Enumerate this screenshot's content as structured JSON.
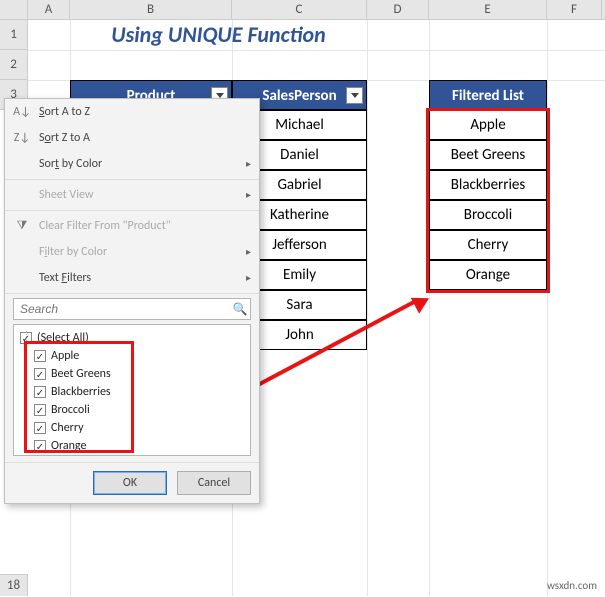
{
  "columns": [
    "A",
    "B",
    "C",
    "D",
    "E",
    "F"
  ],
  "rows": [
    "1",
    "2",
    "3"
  ],
  "lastRow": "18",
  "title": "Using UNIQUE Function",
  "headers": {
    "product": "Product",
    "salesperson": "SalesPerson",
    "filtered": "Filtered List"
  },
  "salesperson": [
    "Michael",
    "Daniel",
    "Gabriel",
    "Katherine",
    "Jefferson",
    "Emily",
    "Sara",
    "John"
  ],
  "filtered": [
    "Apple",
    "Beet Greens",
    "Blackberries",
    "Broccoli",
    "Cherry",
    "Orange"
  ],
  "menu": {
    "sortAZ": "Sort A to Z",
    "sortZA": "Sort Z to A",
    "sortColor": "Sort by Color",
    "sheetView": "Sheet View",
    "clearFilter": "Clear Filter From \"Product\"",
    "filterColor": "Filter by Color",
    "textFilters": "Text Filters",
    "searchPlaceholder": "Search",
    "selectAll": "(Select All)",
    "items": [
      "Apple",
      "Beet Greens",
      "Blackberries",
      "Broccoli",
      "Cherry",
      "Orange"
    ],
    "ok": "OK",
    "cancel": "Cancel"
  },
  "watermark": "wsxdn.com",
  "chart_data": {
    "type": "table",
    "title": "Using UNIQUE Function",
    "tables": {
      "SalesPerson": [
        "Michael",
        "Daniel",
        "Gabriel",
        "Katherine",
        "Jefferson",
        "Emily",
        "Sara",
        "John"
      ],
      "Filtered List": [
        "Apple",
        "Beet Greens",
        "Blackberries",
        "Broccoli",
        "Cherry",
        "Orange"
      ],
      "FilterMenuItems": [
        "Apple",
        "Beet Greens",
        "Blackberries",
        "Broccoli",
        "Cherry",
        "Orange"
      ]
    }
  }
}
